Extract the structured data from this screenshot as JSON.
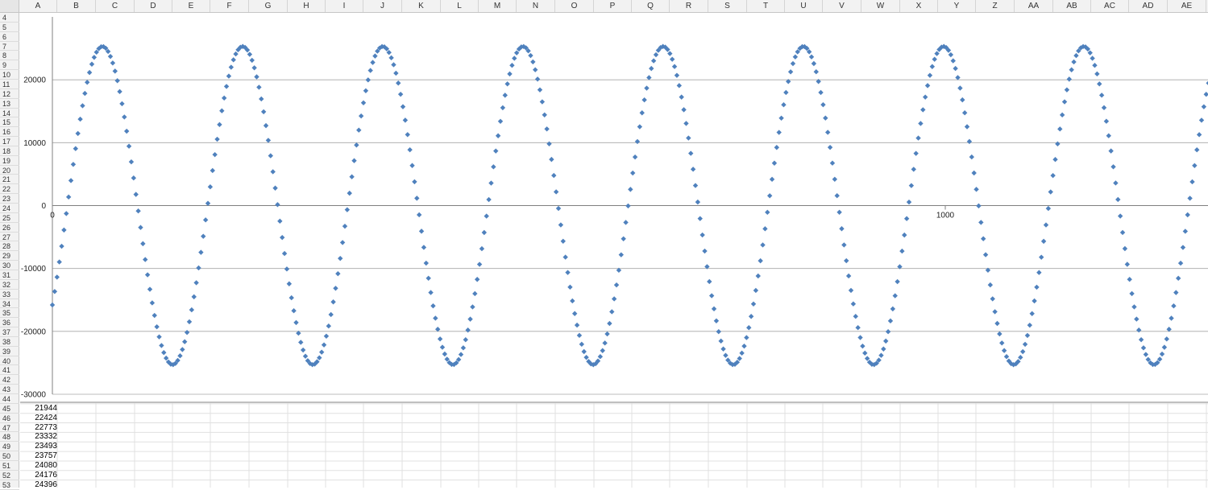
{
  "columns": [
    "A",
    "B",
    "C",
    "D",
    "E",
    "F",
    "G",
    "H",
    "I",
    "J",
    "K",
    "L",
    "M",
    "N",
    "O",
    "P",
    "Q",
    "R",
    "S",
    "T",
    "U",
    "V",
    "W",
    "X",
    "Y",
    "Z",
    "AA",
    "AB",
    "AC",
    "AD",
    "AE"
  ],
  "rows": [
    "4",
    "5",
    "6",
    "7",
    "8",
    "9",
    "10",
    "11",
    "12",
    "13",
    "14",
    "15",
    "16",
    "17",
    "18",
    "19",
    "20",
    "21",
    "22",
    "23",
    "24",
    "25",
    "26",
    "27",
    "28",
    "29",
    "30",
    "31",
    "32",
    "33",
    "34",
    "35",
    "36",
    "37",
    "38",
    "39",
    "40",
    "41",
    "42",
    "43",
    "44",
    "45",
    "46",
    "47",
    "48",
    "49",
    "50",
    "51",
    "52",
    "53"
  ],
  "cells_A": [
    {
      "row": "45",
      "value": "21944"
    },
    {
      "row": "46",
      "value": "22424"
    },
    {
      "row": "47",
      "value": "22773"
    },
    {
      "row": "48",
      "value": "23332"
    },
    {
      "row": "49",
      "value": "23493"
    },
    {
      "row": "50",
      "value": "23757"
    },
    {
      "row": "51",
      "value": "24080"
    },
    {
      "row": "52",
      "value": "24176"
    },
    {
      "row": "53",
      "value": "24396"
    }
  ],
  "colors": {
    "marker": "#4f81bd",
    "gridline": "#a6a6a6",
    "axis": "#808080"
  },
  "chart_data": {
    "type": "scatter",
    "marker": "diamond",
    "y_ticks": [
      "20000",
      "10000",
      "0",
      "-10000",
      "-20000",
      "-30000"
    ],
    "x_ticks": [
      "0",
      "1000"
    ],
    "ylim": [
      -30000,
      30000
    ],
    "xlim": [
      0,
      1300
    ],
    "grid": true,
    "series": [
      {
        "amplitude": 25300,
        "period": 157,
        "x_start": 0,
        "x_end": 1300,
        "x_step": 2.6,
        "y_at_x0": -15800
      }
    ]
  }
}
